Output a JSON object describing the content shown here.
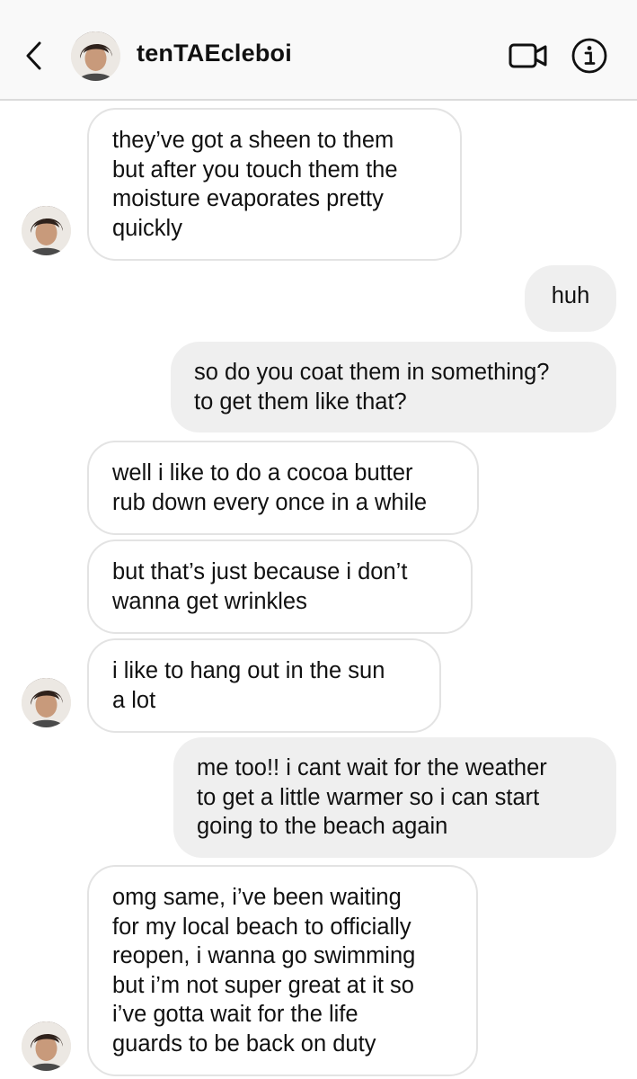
{
  "header": {
    "username": "tenTAEcleboi",
    "back_icon": "chevron-left-icon",
    "video_icon": "video-camera-icon",
    "info_icon": "info-icon"
  },
  "colors": {
    "incoming_border": "#e3e3e3",
    "outgoing_bg": "#efefef",
    "header_bg": "#f9f9f9"
  },
  "messages": [
    {
      "sender": "them",
      "lines": [
        "they’ve got a sheen to them",
        "but after you touch them the",
        "moisture evaporates pretty",
        "quickly"
      ]
    },
    {
      "sender": "me",
      "lines": [
        "huh"
      ]
    },
    {
      "sender": "me",
      "lines": [
        "so do you coat them in something?",
        "to get them like that?"
      ]
    },
    {
      "sender": "them",
      "lines": [
        "well i like to do a cocoa butter",
        "rub down every once in a while"
      ]
    },
    {
      "sender": "them",
      "lines": [
        "but that’s just because i don’t",
        "wanna get wrinkles"
      ]
    },
    {
      "sender": "them",
      "lines": [
        "i like to hang out in the sun",
        "a lot"
      ]
    },
    {
      "sender": "me",
      "lines": [
        "me too!! i cant wait for the weather",
        "to get a little warmer so i can start",
        "going to the beach again"
      ]
    },
    {
      "sender": "them",
      "lines": [
        "omg same, i’ve been waiting",
        "for my local beach to officially",
        "reopen, i wanna go swimming",
        "but i’m not super great at it so",
        "i’ve gotta wait for the life",
        "guards to be back on duty"
      ]
    }
  ]
}
